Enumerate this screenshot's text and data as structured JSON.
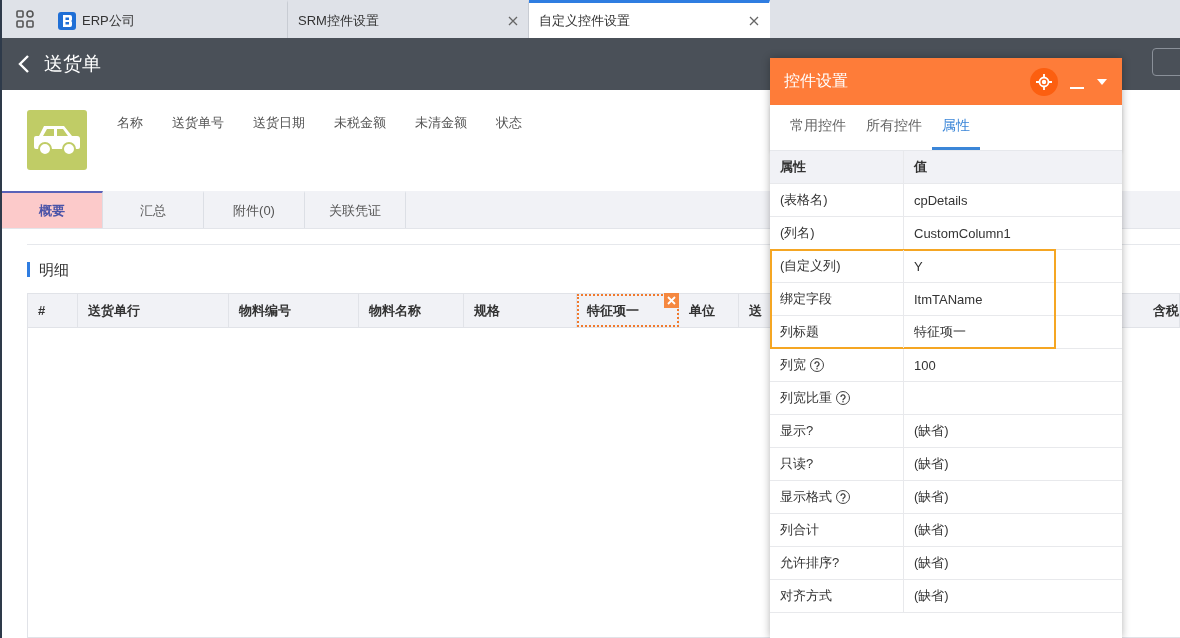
{
  "browser_tabs": [
    {
      "label": "ERP公司",
      "kind": "home",
      "selected": false
    },
    {
      "label": "SRM控件设置",
      "kind": "page",
      "selected": false
    },
    {
      "label": "自定义控件设置",
      "kind": "page",
      "selected": true
    }
  ],
  "header": {
    "title": "送货单"
  },
  "document": {
    "fields": [
      "名称",
      "送货单号",
      "送货日期",
      "未税金额",
      "未清金额",
      "状态"
    ]
  },
  "doc_tabs": [
    {
      "label": "概要",
      "selected": true
    },
    {
      "label": "汇总",
      "selected": false
    },
    {
      "label": "附件(0)",
      "selected": false
    },
    {
      "label": "关联凭证",
      "selected": false
    }
  ],
  "section": {
    "title": "明细"
  },
  "table": {
    "columns": [
      {
        "label": "#",
        "selected": false
      },
      {
        "label": "送货单行",
        "selected": false
      },
      {
        "label": "物料编号",
        "selected": false
      },
      {
        "label": "物料名称",
        "selected": false
      },
      {
        "label": "规格",
        "selected": false
      },
      {
        "label": "特征项一",
        "selected": true
      },
      {
        "label": "单位",
        "selected": false
      },
      {
        "label": "送",
        "selected": false
      },
      {
        "label": "含税",
        "selected": false
      }
    ]
  },
  "panel": {
    "title": "控件设置",
    "tabs": [
      {
        "label": "常用控件",
        "selected": false
      },
      {
        "label": "所有控件",
        "selected": false
      },
      {
        "label": "属性",
        "selected": true
      }
    ],
    "columns": [
      "属性",
      "值"
    ],
    "rows": [
      {
        "name": "(表格名)",
        "value": "cpDetails",
        "help": false,
        "highlighted": false
      },
      {
        "name": "(列名)",
        "value": "CustomColumn1",
        "help": false,
        "highlighted": false
      },
      {
        "name": "(自定义列)",
        "value": "Y",
        "help": false,
        "highlighted": true
      },
      {
        "name": "绑定字段",
        "value": "ItmTAName",
        "help": false,
        "highlighted": true
      },
      {
        "name": "列标题",
        "value": "特征项一",
        "help": false,
        "highlighted": true
      },
      {
        "name": "列宽",
        "value": "100",
        "help": true,
        "highlighted": false
      },
      {
        "name": "列宽比重",
        "help": true,
        "highlighted": false
      },
      {
        "name": "显示?",
        "value": "(缺省)",
        "help": false,
        "highlighted": false
      },
      {
        "name": "只读?",
        "value": "(缺省)",
        "help": false,
        "highlighted": false
      },
      {
        "name": "显示格式",
        "value": "(缺省)",
        "help": true,
        "highlighted": false
      },
      {
        "name": "列合计",
        "value": "(缺省)",
        "help": false,
        "highlighted": false
      },
      {
        "name": "允许排序?",
        "value": "(缺省)",
        "help": false,
        "highlighted": false
      },
      {
        "name": "对齐方式",
        "value": "(缺省)",
        "help": false,
        "highlighted": false
      }
    ]
  }
}
